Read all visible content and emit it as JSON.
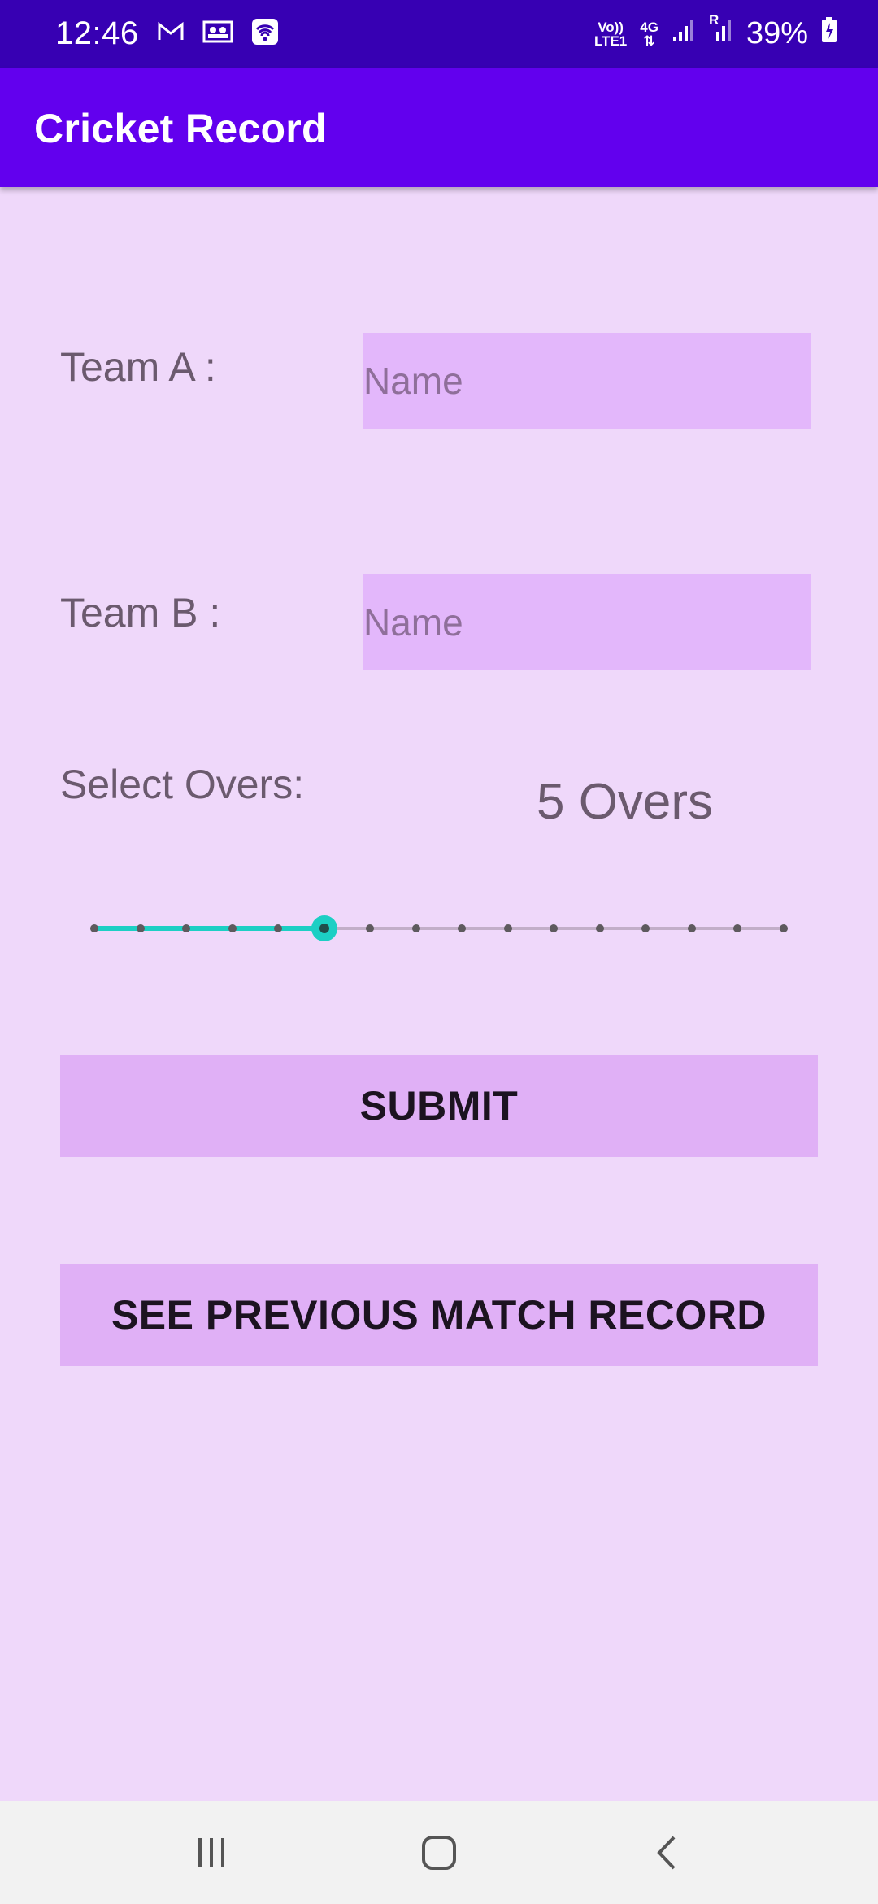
{
  "status_bar": {
    "time": "12:46",
    "notification_icons": [
      "gmail-icon",
      "contacts-card-icon",
      "wifi-hotspot-icon"
    ],
    "network_label_top": "Vo))",
    "network_label_bottom": "LTE1",
    "network_type": "4G",
    "roaming": "R",
    "battery": "39%"
  },
  "app_bar": {
    "title": "Cricket Record"
  },
  "form": {
    "team_a_label": "Team A :",
    "team_a_placeholder": "Name",
    "team_a_value": "",
    "team_b_label": "Team B :",
    "team_b_placeholder": "Name",
    "team_b_value": "",
    "overs_label": "Select Overs:",
    "overs_display": "5 Overs",
    "slider": {
      "min": 0,
      "max": 15,
      "value": 5,
      "accent_color": "#1ccfc4"
    }
  },
  "buttons": {
    "submit_label": "SUBMIT",
    "previous_label": "SEE PREVIOUS MATCH RECORD"
  },
  "nav_bar": {
    "items": [
      "recent-apps-icon",
      "home-icon",
      "back-icon"
    ]
  },
  "colors": {
    "primary": "#6200ee",
    "primary_dark": "#3700b3",
    "background": "#efd8fa",
    "input_background": "#e3b7fb",
    "button_background": "#e0b0f6"
  }
}
